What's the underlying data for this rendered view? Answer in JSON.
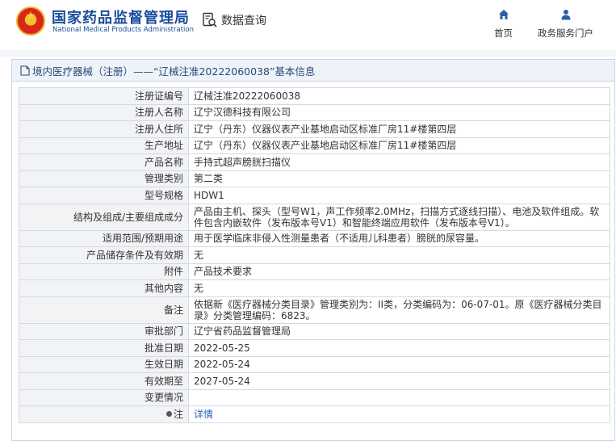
{
  "header": {
    "brand_cn": "国家药品监督管理局",
    "brand_en": "National Medical Products Administration",
    "data_query": "数据查询",
    "nav": [
      {
        "label": "首页",
        "icon": "home-icon"
      },
      {
        "label": "政务服务门户",
        "icon": "user-icon"
      }
    ]
  },
  "panel": {
    "title": "境内医疗器械（注册）——“辽械注准20222060038”基本信息"
  },
  "fields": [
    {
      "label": "注册证编号",
      "value": "辽械注准20222060038"
    },
    {
      "label": "注册人名称",
      "value": "辽宁汉德科技有限公司"
    },
    {
      "label": "注册人住所",
      "value": "辽宁（丹东）仪器仪表产业基地启动区标准厂房11#楼第四层"
    },
    {
      "label": "生产地址",
      "value": "辽宁（丹东）仪器仪表产业基地启动区标准厂房11#楼第四层"
    },
    {
      "label": "产品名称",
      "value": "手持式超声膀胱扫描仪"
    },
    {
      "label": "管理类别",
      "value": "第二类"
    },
    {
      "label": "型号规格",
      "value": "HDW1"
    },
    {
      "label": "结构及组成/主要组成成分",
      "value": "产品由主机、探头（型号W1，声工作频率2.0MHz，扫描方式逐线扫描）、电池及软件组成。软件包含内嵌软件（发布版本号V1）和智能终端应用软件（发布版本号V1）。"
    },
    {
      "label": "适用范围/预期用途",
      "value": "用于医学临床非侵入性测量患者（不适用儿科患者）膀胱的尿容量。"
    },
    {
      "label": "产品储存条件及有效期",
      "value": "无"
    },
    {
      "label": "附件",
      "value": "产品技术要求"
    },
    {
      "label": "其他内容",
      "value": "无"
    },
    {
      "label": "备注",
      "value": "依据新《医疗器械分类目录》管理类别为：II类，分类编码为：06-07-01。原《医疗器械分类目录》分类管理编码：6823。"
    },
    {
      "label": "审批部门",
      "value": "辽宁省药品监督管理局"
    },
    {
      "label": "批准日期",
      "value": "2022-05-25"
    },
    {
      "label": "生效日期",
      "value": "2022-05-24"
    },
    {
      "label": "有效期至",
      "value": "2027-05-24"
    },
    {
      "label": "变更情况",
      "value": ""
    }
  ],
  "note_row": {
    "label": "注",
    "link": "详情"
  },
  "colors": {
    "brand": "#1a4d9c",
    "link": "#2a63b8",
    "label_bg": "#f2f3f5",
    "border": "#d3d9e3"
  }
}
